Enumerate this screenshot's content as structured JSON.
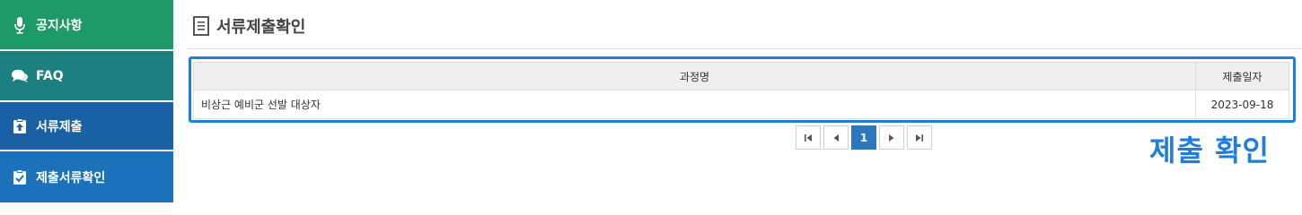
{
  "sidebar": {
    "items": [
      {
        "label": "공지사항",
        "icon": "microphone-icon"
      },
      {
        "label": "FAQ",
        "icon": "chat-bubbles-icon"
      },
      {
        "label": "서류제출",
        "icon": "upload-clipboard-icon"
      },
      {
        "label": "제출서류확인",
        "icon": "check-clipboard-icon"
      }
    ]
  },
  "main": {
    "title": "서류제출확인",
    "table": {
      "headers": [
        "과정명",
        "제출일자"
      ],
      "rows": [
        {
          "course": "비상근 예비군 선발 대상자",
          "date": "2023-09-18"
        }
      ]
    },
    "pagination": {
      "current_page": "1",
      "first_symbol": "⏮",
      "prev_symbol": "◀",
      "next_symbol": "▶",
      "last_symbol": "⏭"
    },
    "annotation": "제출 확인"
  },
  "colors": {
    "nav_1": "#1e9a68",
    "nav_2": "#1c7f80",
    "nav_3": "#1a60a4",
    "nav_4": "#1b72bb",
    "highlight": "#1a7fe0",
    "active_page": "#2d78bd"
  }
}
